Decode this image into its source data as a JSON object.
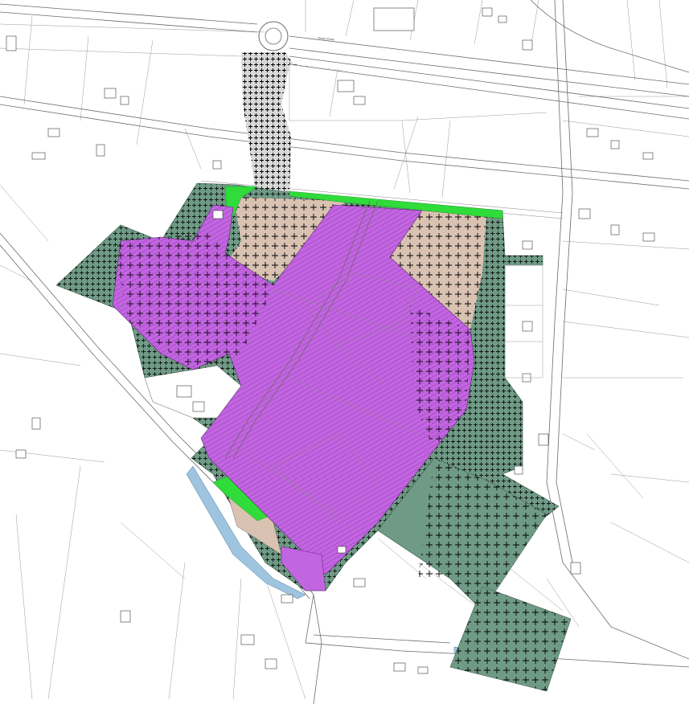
{
  "map": {
    "colors": {
      "background": "#ffffff",
      "zone_green_dark": "#6f9a86",
      "zone_green_light": "#2fdc3a",
      "zone_beige": "#d9c2b2",
      "zone_purple": "#c265e0",
      "water_blue": "#9fc4e0",
      "line": "#6b6b6b"
    },
    "legend_patterns": [
      "hatched",
      "cross-marked"
    ],
    "roads": [
      {
        "label": "Strada statale"
      }
    ],
    "zones": [
      {
        "type": "green-buffer",
        "color_key": "zone_green_dark",
        "pattern": "cross"
      },
      {
        "type": "industrial-purple",
        "color_key": "zone_purple",
        "pattern": "hatch"
      },
      {
        "type": "beige-area",
        "color_key": "zone_beige",
        "pattern": "cross"
      },
      {
        "type": "light-green-strip",
        "color_key": "zone_green_light",
        "pattern": "none"
      }
    ]
  }
}
